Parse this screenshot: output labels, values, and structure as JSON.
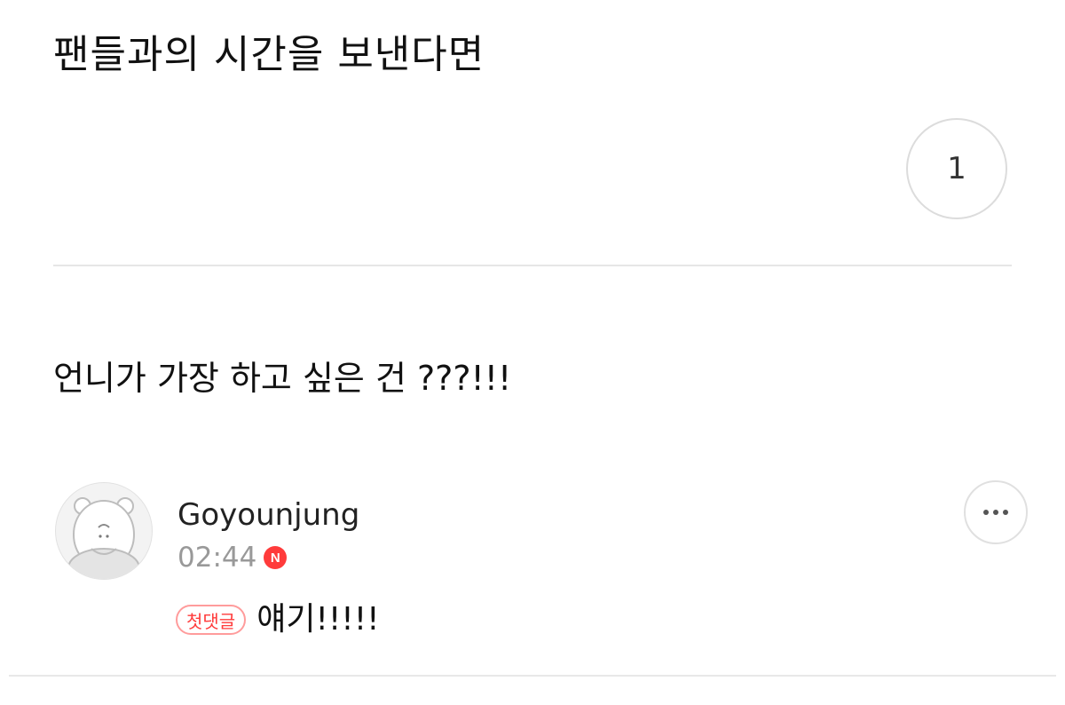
{
  "post": {
    "title": "팬들과의 시간을 보낸다면",
    "count": "1",
    "question": "언니가 가장 하고 싶은 건 ???!!!"
  },
  "comment": {
    "author": "Goyounjung",
    "time": "02:44",
    "new_badge": "N",
    "tag": "첫댓글",
    "text": "얘기!!!!!",
    "avatar_icon": "hamster-avatar-icon",
    "more_icon": "more-horizontal-icon"
  },
  "colors": {
    "badge_red": "#ff3b3b",
    "tag_border": "#ff9c9c",
    "meta_gray": "#999999",
    "divider": "#e6e6e6"
  }
}
